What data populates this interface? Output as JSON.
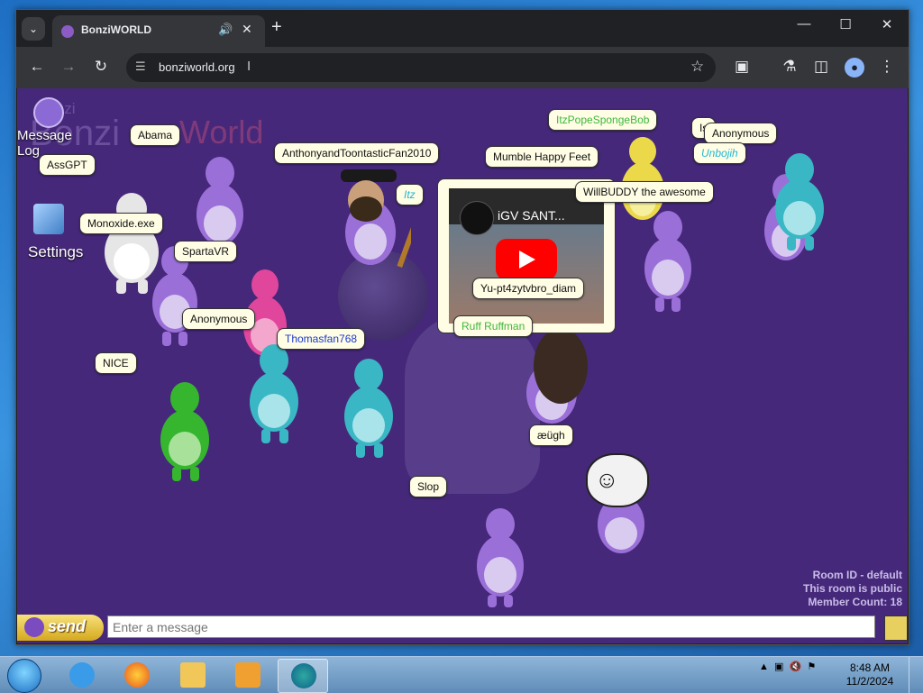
{
  "browser": {
    "tab_title": "BonziWORLD",
    "url": "bonziworld.org"
  },
  "page": {
    "watermark_top": "Bonzi",
    "watermark_brand": "Bonzi",
    "watermark_world": "World",
    "desktop_icons": [
      {
        "label_line1": "Message",
        "label_line2": "Log"
      },
      {
        "label_line1": "Settings"
      }
    ],
    "video_title": "iGV SANT...",
    "room_info": {
      "room_id": "Room ID - default",
      "visibility": "This room is public",
      "member_count": "Member Count: 18"
    },
    "bubbles": [
      {
        "text": "Abama"
      },
      {
        "text": "AssGPT"
      },
      {
        "text": "Monoxide.exe"
      },
      {
        "text": "SpartaVR"
      },
      {
        "text": "Anonymous"
      },
      {
        "text": "NICE"
      },
      {
        "text": "AnthonyandToontasticFan2010"
      },
      {
        "text": "Thomasfan768"
      },
      {
        "text": "Itz"
      },
      {
        "text": "ItzPopeSpongeBob"
      },
      {
        "text": "Mumble Happy Feet"
      },
      {
        "text": "WillBUDDY the awesome"
      },
      {
        "text": "Is"
      },
      {
        "text": "Anonymous"
      },
      {
        "text": "Unbojih"
      },
      {
        "text": "Yu-pt4zytvbro_diam"
      },
      {
        "text": "Ruff Ruffman"
      },
      {
        "text": "æügh"
      },
      {
        "text": "Slop"
      }
    ],
    "chat": {
      "send_label": "send",
      "placeholder": "Enter a message"
    }
  },
  "taskbar": {
    "time": "8:48 AM",
    "date": "11/2/2024"
  },
  "colors": {
    "page_bg": "#46287a",
    "bonzi_purple": "#9b6fd8",
    "bubble_bg": "#fffde4",
    "green_name": "#3db83d",
    "cyan_name": "#1fb8d8",
    "blue_name": "#1b3bd0"
  },
  "icons": [
    "chevron-down-icon",
    "speaker-icon",
    "close-icon",
    "plus-icon",
    "minimize-icon",
    "maximize-icon",
    "back-icon",
    "forward-icon",
    "reload-icon",
    "site-settings-icon",
    "star-icon",
    "extensions-icon",
    "labs-icon",
    "sidepanel-icon",
    "profile-icon",
    "more-icon",
    "emoji-icon",
    "start-icon",
    "ie-icon",
    "firefox-icon",
    "explorer-icon",
    "media-icon",
    "chrome-icon"
  ]
}
